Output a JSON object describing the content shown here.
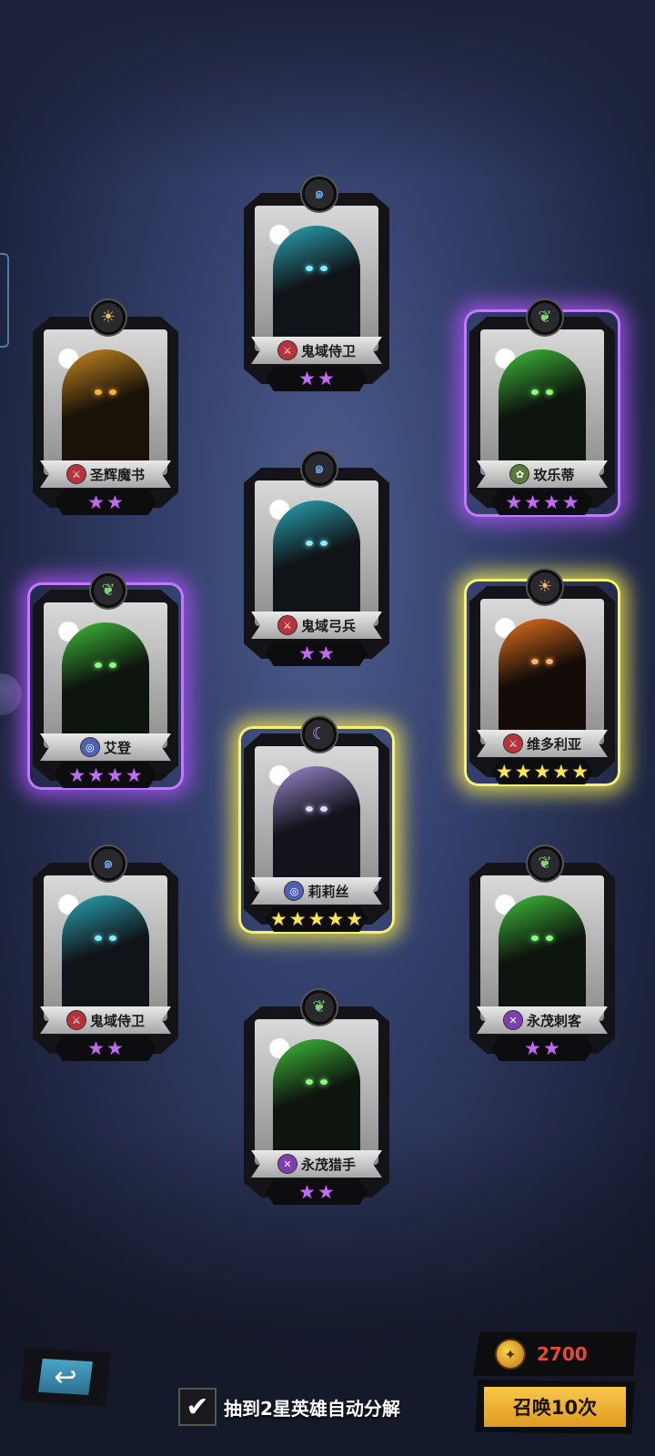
{
  "colors": {
    "purple_glow": "#b04dff",
    "gold_glow": "#f2e24a",
    "summon_button": "#f0b83a",
    "currency_text": "#e44a3a"
  },
  "cards": [
    {
      "name": "鬼域侍卫",
      "stars": 2,
      "rarity": "normal",
      "faction_icon": "swirl-icon",
      "class_icon": "sword-icon",
      "theme": "teal"
    },
    {
      "name": "圣辉魔书",
      "stars": 2,
      "rarity": "normal",
      "faction_icon": "sun-icon",
      "class_icon": "sword-icon",
      "theme": "gold"
    },
    {
      "name": "玫乐蒂",
      "stars": 4,
      "rarity": "purple",
      "faction_icon": "leaf-icon",
      "class_icon": "forest-icon",
      "theme": "green"
    },
    {
      "name": "鬼域弓兵",
      "stars": 2,
      "rarity": "normal",
      "faction_icon": "swirl-icon",
      "class_icon": "sword-icon",
      "theme": "teal"
    },
    {
      "name": "艾登",
      "stars": 4,
      "rarity": "purple",
      "faction_icon": "leaf-icon",
      "class_icon": "orb-icon",
      "theme": "green"
    },
    {
      "name": "维多利亚",
      "stars": 5,
      "rarity": "gold",
      "faction_icon": "sun-icon",
      "class_icon": "sword-icon",
      "theme": "orange"
    },
    {
      "name": "莉莉丝",
      "stars": 5,
      "rarity": "gold",
      "faction_icon": "moon-icon",
      "class_icon": "orb-icon",
      "theme": "violet"
    },
    {
      "name": "鬼域侍卫",
      "stars": 2,
      "rarity": "normal",
      "faction_icon": "swirl-icon",
      "class_icon": "sword-icon",
      "theme": "teal"
    },
    {
      "name": "永茂刺客",
      "stars": 2,
      "rarity": "normal",
      "faction_icon": "leaf-icon",
      "class_icon": "dagger-icon",
      "theme": "green"
    },
    {
      "name": "永茂猎手",
      "stars": 2,
      "rarity": "normal",
      "faction_icon": "leaf-icon",
      "class_icon": "dagger-icon",
      "theme": "green"
    }
  ],
  "bottom": {
    "back_icon": "back-arrow-icon",
    "auto_decompose_label": "抽到2星英雄自动分解",
    "auto_decompose_checked": true,
    "currency_value": "2700",
    "currency_icon": "summon-coin-icon",
    "summon_label": "召唤10次"
  }
}
